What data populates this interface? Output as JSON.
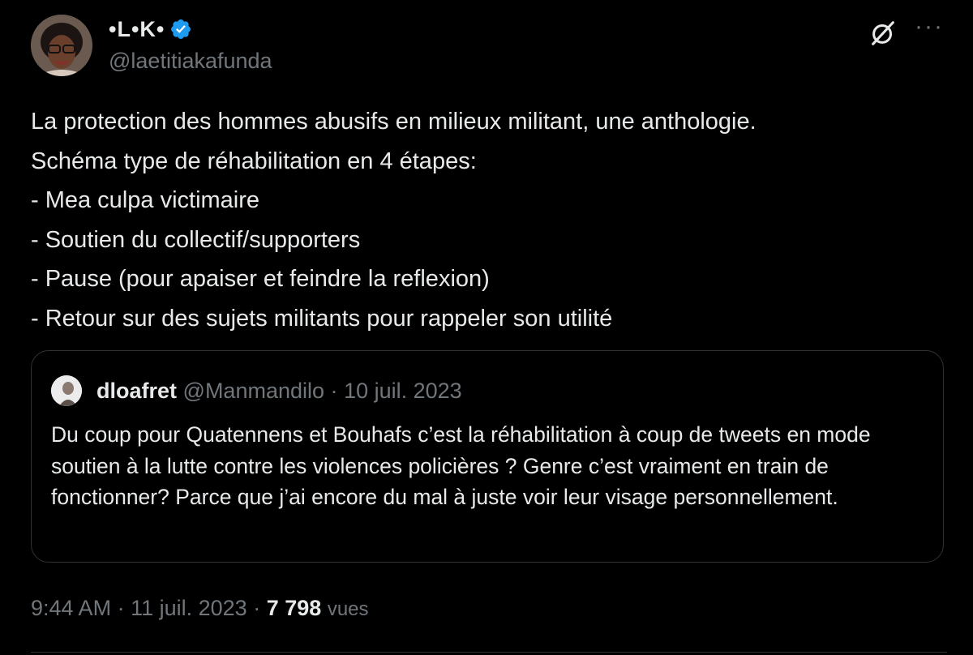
{
  "author": {
    "display_name": "•L•K•",
    "handle": "@laetitiakafunda",
    "verified": true
  },
  "tweet": {
    "lines": [
      "La protection des hommes abusifs en milieux militant, une anthologie.",
      "Schéma type de réhabilitation en 4 étapes:",
      "- Mea culpa victimaire",
      "- Soutien du collectif/supporters",
      "- Pause (pour apaiser et feindre la reflexion)",
      "- Retour sur des sujets militants pour rappeler son utilité"
    ]
  },
  "quote": {
    "name": "dloafret",
    "handle": "@Manmandilo",
    "separator": "·",
    "date": "10 juil. 2023",
    "text": "Du coup pour Quatennens et Bouhafs c’est la réhabilitation à coup de tweets en mode soutien à la lutte contre les violences policières ? Genre c’est vraiment en train de fonctionner? Parce que j’ai encore du mal à juste voir leur visage personnellement."
  },
  "meta": {
    "time": "9:44 AM",
    "sep1": "·",
    "date": "11 juil. 2023",
    "sep2": "·",
    "views_count": "7 798",
    "views_label": "vues"
  },
  "icons": {
    "verified": "verified-badge-icon",
    "grok": "grok-icon",
    "more": "more-icon"
  },
  "colors": {
    "background": "#000000",
    "text": "#e7e9ea",
    "secondary": "#71767b",
    "verified": "#1d9bf0",
    "border": "#2f3336"
  }
}
